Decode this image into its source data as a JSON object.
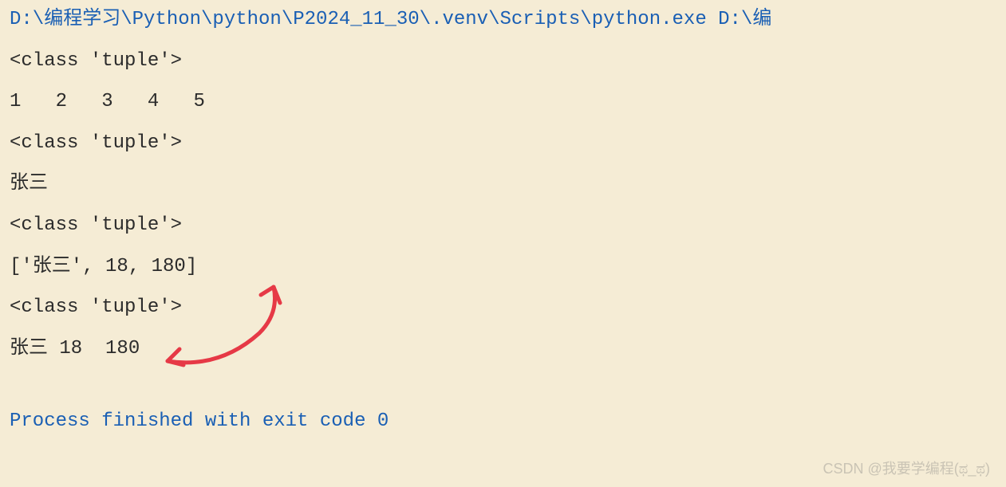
{
  "output": {
    "command_line": "D:\\编程学习\\Python\\python\\P2024_11_30\\.venv\\Scripts\\python.exe D:\\编",
    "line1": "<class 'tuple'>",
    "line2": "1   2   3   4   5",
    "line3": "<class 'tuple'>",
    "line4": "张三",
    "line5": "<class 'tuple'>",
    "line6": "['张三', 18, 180]",
    "line7": "<class 'tuple'>",
    "line8": "张三 18  180",
    "exit_line": "Process finished with exit code 0"
  },
  "watermark": "CSDN @我要学编程(ಥ_ಥ)"
}
